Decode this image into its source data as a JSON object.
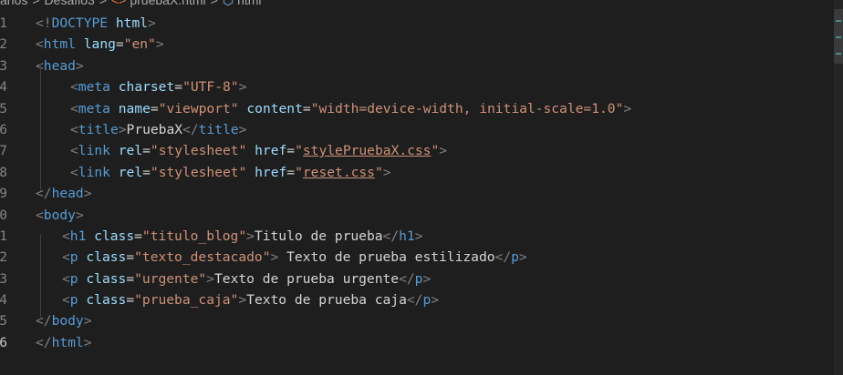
{
  "breadcrumb": {
    "items": [
      "años",
      "Desafio3",
      "pruebaX.html",
      "html"
    ],
    "separator": ">"
  },
  "line_numbers": [
    "1",
    "2",
    "3",
    "4",
    "5",
    "6",
    "7",
    "8",
    "9",
    "0",
    "1",
    "2",
    "3",
    "4",
    "5",
    "6"
  ],
  "active_line_index": 15,
  "lines": [
    [
      {
        "c": "p",
        "v": "<!"
      },
      {
        "c": "t",
        "v": "DOCTYPE"
      },
      {
        "c": "tx",
        "v": " "
      },
      {
        "c": "a",
        "v": "html"
      },
      {
        "c": "p",
        "v": ">"
      }
    ],
    [
      {
        "c": "p",
        "v": "<"
      },
      {
        "c": "t",
        "v": "html"
      },
      {
        "c": "tx",
        "v": " "
      },
      {
        "c": "a",
        "v": "lang"
      },
      {
        "c": "eq",
        "v": "="
      },
      {
        "c": "s",
        "v": "\"en\""
      },
      {
        "c": "p",
        "v": ">"
      }
    ],
    [
      {
        "c": "p",
        "v": "<"
      },
      {
        "c": "t",
        "v": "head"
      },
      {
        "c": "p",
        "v": ">"
      }
    ],
    [
      {
        "c": "p",
        "v": "<"
      },
      {
        "c": "t",
        "v": "meta"
      },
      {
        "c": "tx",
        "v": " "
      },
      {
        "c": "a",
        "v": "charset"
      },
      {
        "c": "eq",
        "v": "="
      },
      {
        "c": "s",
        "v": "\"UTF-8\""
      },
      {
        "c": "p",
        "v": ">"
      }
    ],
    [
      {
        "c": "p",
        "v": "<"
      },
      {
        "c": "t",
        "v": "meta"
      },
      {
        "c": "tx",
        "v": " "
      },
      {
        "c": "a",
        "v": "name"
      },
      {
        "c": "eq",
        "v": "="
      },
      {
        "c": "s",
        "v": "\"viewport\""
      },
      {
        "c": "tx",
        "v": " "
      },
      {
        "c": "a",
        "v": "content"
      },
      {
        "c": "eq",
        "v": "="
      },
      {
        "c": "s",
        "v": "\"width=device-width, initial-scale=1.0\""
      },
      {
        "c": "p",
        "v": ">"
      }
    ],
    [
      {
        "c": "p",
        "v": "<"
      },
      {
        "c": "t",
        "v": "title"
      },
      {
        "c": "p",
        "v": ">"
      },
      {
        "c": "tx",
        "v": "PruebaX"
      },
      {
        "c": "p",
        "v": "</"
      },
      {
        "c": "t",
        "v": "title"
      },
      {
        "c": "p",
        "v": ">"
      }
    ],
    [
      {
        "c": "p",
        "v": "<"
      },
      {
        "c": "t",
        "v": "link"
      },
      {
        "c": "tx",
        "v": " "
      },
      {
        "c": "a",
        "v": "rel"
      },
      {
        "c": "eq",
        "v": "="
      },
      {
        "c": "s",
        "v": "\"stylesheet\""
      },
      {
        "c": "tx",
        "v": " "
      },
      {
        "c": "a",
        "v": "href"
      },
      {
        "c": "eq",
        "v": "="
      },
      {
        "c": "s",
        "v": "\""
      },
      {
        "c": "s ul",
        "v": "stylePruebaX.css"
      },
      {
        "c": "s",
        "v": "\""
      },
      {
        "c": "p",
        "v": ">"
      }
    ],
    [
      {
        "c": "p",
        "v": "<"
      },
      {
        "c": "t",
        "v": "link"
      },
      {
        "c": "tx",
        "v": " "
      },
      {
        "c": "a",
        "v": "rel"
      },
      {
        "c": "eq",
        "v": "="
      },
      {
        "c": "s",
        "v": "\"stylesheet\""
      },
      {
        "c": "tx",
        "v": " "
      },
      {
        "c": "a",
        "v": "href"
      },
      {
        "c": "eq",
        "v": "="
      },
      {
        "c": "s",
        "v": "\""
      },
      {
        "c": "s ul",
        "v": "reset.css"
      },
      {
        "c": "s",
        "v": "\""
      },
      {
        "c": "p",
        "v": ">"
      }
    ],
    [
      {
        "c": "p",
        "v": "</"
      },
      {
        "c": "t",
        "v": "head"
      },
      {
        "c": "p",
        "v": ">"
      }
    ],
    [
      {
        "c": "p",
        "v": "<"
      },
      {
        "c": "t",
        "v": "body"
      },
      {
        "c": "p",
        "v": ">"
      }
    ],
    [
      {
        "c": "p",
        "v": "<"
      },
      {
        "c": "t",
        "v": "h1"
      },
      {
        "c": "tx",
        "v": " "
      },
      {
        "c": "a",
        "v": "class"
      },
      {
        "c": "eq",
        "v": "="
      },
      {
        "c": "s",
        "v": "\"titulo_blog\""
      },
      {
        "c": "p",
        "v": ">"
      },
      {
        "c": "tx",
        "v": "Titulo de prueba"
      },
      {
        "c": "p",
        "v": "</"
      },
      {
        "c": "t",
        "v": "h1"
      },
      {
        "c": "p",
        "v": ">"
      }
    ],
    [
      {
        "c": "p",
        "v": "<"
      },
      {
        "c": "t",
        "v": "p"
      },
      {
        "c": "tx",
        "v": " "
      },
      {
        "c": "a",
        "v": "class"
      },
      {
        "c": "eq",
        "v": "="
      },
      {
        "c": "s",
        "v": "\"texto_destacado\""
      },
      {
        "c": "p",
        "v": ">"
      },
      {
        "c": "tx",
        "v": " Texto de prueba estilizado"
      },
      {
        "c": "p",
        "v": "</"
      },
      {
        "c": "t",
        "v": "p"
      },
      {
        "c": "p",
        "v": ">"
      }
    ],
    [
      {
        "c": "p",
        "v": "<"
      },
      {
        "c": "t",
        "v": "p"
      },
      {
        "c": "tx",
        "v": " "
      },
      {
        "c": "a",
        "v": "class"
      },
      {
        "c": "eq",
        "v": "="
      },
      {
        "c": "s",
        "v": "\"urgente\""
      },
      {
        "c": "p",
        "v": ">"
      },
      {
        "c": "tx",
        "v": "Texto de prueba urgente"
      },
      {
        "c": "p",
        "v": "</"
      },
      {
        "c": "t",
        "v": "p"
      },
      {
        "c": "p",
        "v": ">"
      }
    ],
    [
      {
        "c": "p",
        "v": "<"
      },
      {
        "c": "t",
        "v": "p"
      },
      {
        "c": "tx",
        "v": " "
      },
      {
        "c": "a",
        "v": "class"
      },
      {
        "c": "eq",
        "v": "="
      },
      {
        "c": "s",
        "v": "\"prueba_caja\""
      },
      {
        "c": "p",
        "v": ">"
      },
      {
        "c": "tx",
        "v": "Texto de prueba caja"
      },
      {
        "c": "p",
        "v": "</"
      },
      {
        "c": "t",
        "v": "p"
      },
      {
        "c": "p",
        "v": ">"
      }
    ],
    [
      {
        "c": "p",
        "v": "</"
      },
      {
        "c": "t",
        "v": "body"
      },
      {
        "c": "p",
        "v": ">"
      }
    ],
    [
      {
        "c": "p",
        "v": "</"
      },
      {
        "c": "t",
        "v": "html"
      },
      {
        "c": "p",
        "v": ">"
      }
    ]
  ],
  "colors": {
    "background": "#1e1e1e",
    "tag": "#569cd6",
    "attribute": "#9cdcfe",
    "string": "#ce9178",
    "punctuation": "#808080",
    "text": "#d4d4d4",
    "line_number": "#858585"
  }
}
